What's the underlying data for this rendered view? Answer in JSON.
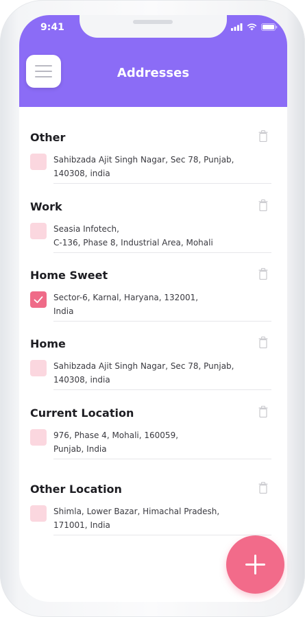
{
  "status_bar": {
    "time": "9:41"
  },
  "header": {
    "title": "Addresses"
  },
  "addresses": [
    {
      "label": "Other",
      "line1": "Sahibzada Ajit Singh Nagar, Sec 78, Punjab,",
      "line2": "140308, india",
      "selected": false
    },
    {
      "label": "Work",
      "line1": "Seasia Infotech,",
      "line2": "C-136, Phase 8, Industrial Area, Mohali",
      "selected": false
    },
    {
      "label": "Home Sweet",
      "line1": "Sector-6, Karnal, Haryana, 132001,",
      "line2": "India",
      "selected": true
    },
    {
      "label": "Home",
      "line1": "Sahibzada Ajit Singh Nagar, Sec 78, Punjab,",
      "line2": "140308, india",
      "selected": false
    },
    {
      "label": "Current Location",
      "line1": "976, Phase 4, Mohali, 160059,",
      "line2": "Punjab, India",
      "selected": false
    },
    {
      "label": "Other Location",
      "line1": "Shimla, Lower Bazar, Himachal Pradesh,",
      "line2": "171001, India",
      "selected": false
    }
  ],
  "colors": {
    "header": "#8b6cf6",
    "accent": "#f26b8a",
    "checkbox_unchecked": "#fbd7df",
    "checkbox_checked": "#ef6b88"
  },
  "icons": {
    "menu": "hamburger-menu-icon",
    "delete": "trash-icon",
    "add": "plus-icon",
    "selected": "check-icon"
  }
}
